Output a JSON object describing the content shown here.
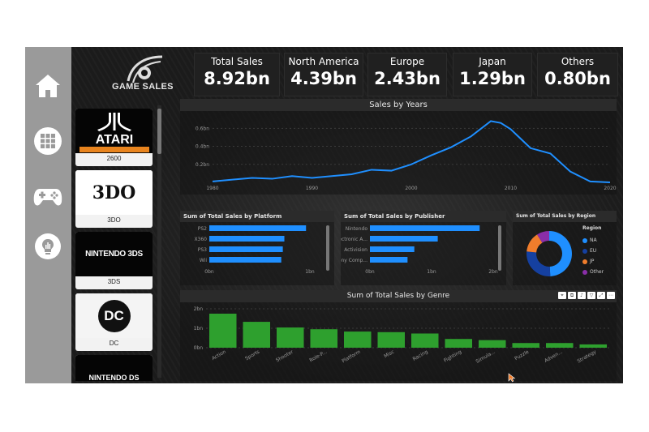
{
  "nav": {
    "items": [
      {
        "name": "home-icon"
      },
      {
        "name": "grid-icon"
      },
      {
        "name": "gamepad-icon"
      },
      {
        "name": "insights-icon"
      }
    ]
  },
  "logo": {
    "text": "GAME SALES"
  },
  "kpis": [
    {
      "label": "Total Sales",
      "value": "8.92bn"
    },
    {
      "label": "North America",
      "value": "4.39bn"
    },
    {
      "label": "Europe",
      "value": "2.43bn"
    },
    {
      "label": "Japan",
      "value": "1.29bn"
    },
    {
      "label": "Others",
      "value": "0.80bn"
    }
  ],
  "platforms": [
    {
      "label": "2600",
      "logo": "ATARI"
    },
    {
      "label": "3DO",
      "logo": "3DO"
    },
    {
      "label": "3DS",
      "logo": "NINTENDO 3DS"
    },
    {
      "label": "DC",
      "logo": "DC"
    },
    {
      "label": "",
      "logo": "NINTENDO DS"
    }
  ],
  "panels": {
    "years_title": "Sales by Years",
    "platform_title": "Sum of Total Sales by Platform",
    "publisher_title": "Sum of Total Sales by Publisher",
    "region_title": "Sum of Total Sales by Region",
    "genre_title": "Sum of Total Sales by Genre"
  },
  "region_legend": {
    "title": "Region",
    "items": [
      {
        "label": "NA",
        "color": "#1f8fff"
      },
      {
        "label": "EU",
        "color": "#1540a0"
      },
      {
        "label": "JP",
        "color": "#f07d2c"
      },
      {
        "label": "Other",
        "color": "#8a2ea8"
      }
    ]
  },
  "colors": {
    "accent": "#1f8fff",
    "genre_bar": "#2ea02e",
    "background": "#141414"
  },
  "chart_data": [
    {
      "type": "line",
      "title": "Sales by Years",
      "x_ticks": [
        "1980",
        "1990",
        "2000",
        "2010",
        "2020"
      ],
      "y_ticks": [
        "0.6bn",
        "0.4bn",
        "0.2bn"
      ],
      "x": [
        1980,
        1982,
        1984,
        1986,
        1988,
        1990,
        1992,
        1994,
        1996,
        1998,
        2000,
        2002,
        2004,
        2006,
        2008,
        2009,
        2010,
        2012,
        2014,
        2016,
        2018,
        2020
      ],
      "values": [
        0.01,
        0.03,
        0.05,
        0.04,
        0.07,
        0.05,
        0.07,
        0.09,
        0.14,
        0.13,
        0.2,
        0.3,
        0.39,
        0.51,
        0.68,
        0.66,
        0.59,
        0.38,
        0.32,
        0.12,
        0.01,
        0.0
      ],
      "ylim": [
        0,
        0.72
      ],
      "xlim": [
        1980,
        2020
      ]
    },
    {
      "type": "bar",
      "title": "Sum of Total Sales by Platform",
      "categories": [
        "PS2",
        "X360",
        "PS3",
        "Wii"
      ],
      "values": [
        1.25,
        0.97,
        0.95,
        0.93
      ],
      "x_ticks": [
        "0bn",
        "1bn"
      ],
      "xlim": [
        0,
        1.3
      ]
    },
    {
      "type": "bar",
      "title": "Sum of Total Sales by Publisher",
      "categories": [
        "Nintendo",
        "Electronic A...",
        "Activision",
        "Sony Comp..."
      ],
      "values": [
        1.78,
        1.1,
        0.72,
        0.61
      ],
      "x_ticks": [
        "0bn",
        "1bn",
        "2bn"
      ],
      "xlim": [
        0,
        2
      ]
    },
    {
      "type": "pie",
      "title": "Sum of Total Sales by Region",
      "categories": [
        "NA",
        "EU",
        "JP",
        "Other"
      ],
      "values": [
        4.39,
        2.43,
        1.29,
        0.8
      ]
    },
    {
      "type": "bar",
      "title": "Sum of Total Sales by Genre",
      "categories": [
        "Action",
        "Sports",
        "Shooter",
        "Role-P...",
        "Platform",
        "Misc",
        "Racing",
        "Fighting",
        "Simula...",
        "Puzzle",
        "Adven...",
        "Strategy"
      ],
      "values": [
        1.75,
        1.33,
        1.04,
        0.95,
        0.83,
        0.8,
        0.73,
        0.45,
        0.39,
        0.24,
        0.24,
        0.17
      ],
      "y_ticks": [
        "2bn",
        "1bn",
        "0bn"
      ],
      "ylim": [
        0,
        2
      ]
    }
  ]
}
